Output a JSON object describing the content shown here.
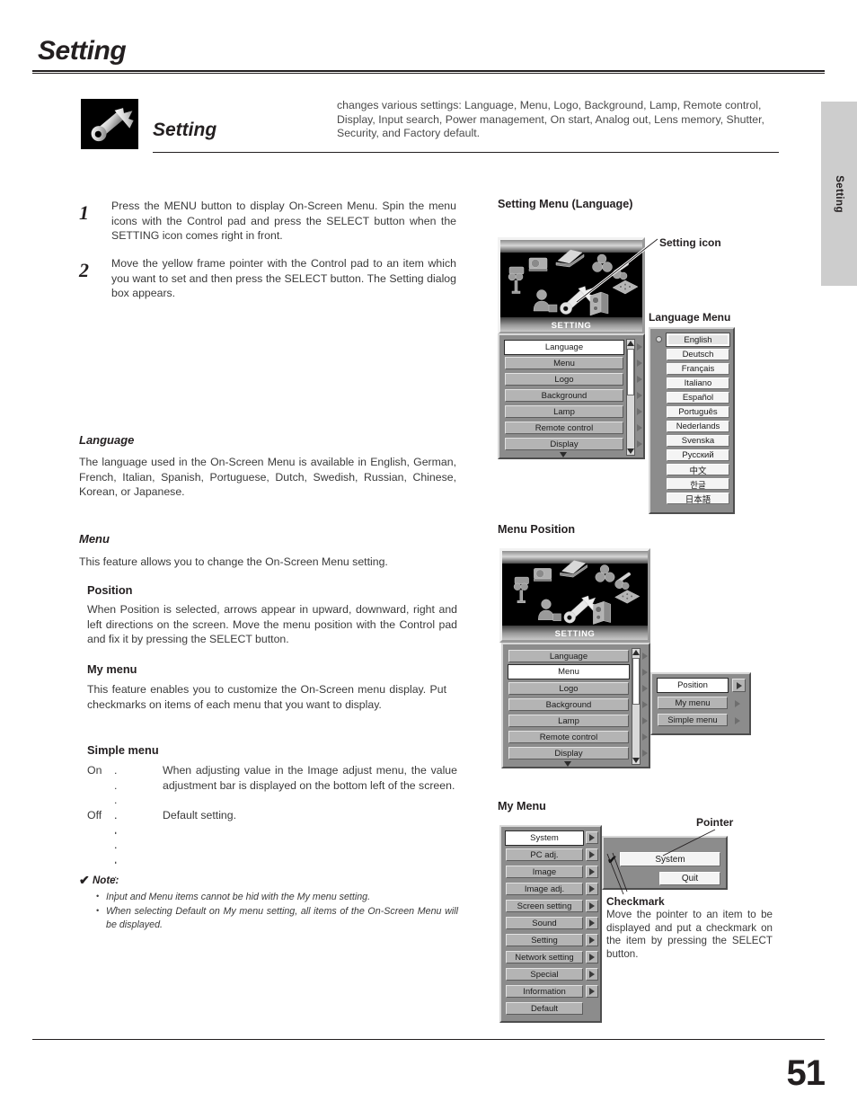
{
  "page": {
    "title": "Setting",
    "number": "51",
    "side_tab_label": "Setting"
  },
  "banner": {
    "icon_name": "setting-wrench-icon",
    "title": "Setting",
    "description": "changes various settings: Language, Menu, Logo, Background, Lamp, Remote control, Display, Input search, Power management, On start, Analog out, Lens memory, Shutter, Security, and Factory default."
  },
  "steps": [
    {
      "number": "1",
      "text": "Press the MENU button to display On-Screen Menu.  Spin the menu icons with the Control pad and press the SELECT button when the SETTING icon comes right in front."
    },
    {
      "number": "2",
      "text": "Move the yellow frame pointer with the Control pad to an item which you want to set and then press the SELECT button.  The Setting dialog box appears."
    }
  ],
  "sections": {
    "language": {
      "heading": "Language",
      "body": "The language used in the On-Screen Menu is available in English, German, French, Italian, Spanish, Portuguese, Dutch, Swedish, Russian, Chinese, Korean, or Japanese."
    },
    "menu": {
      "heading": "Menu",
      "body": "This feature allows you to change the On-Screen Menu setting."
    },
    "position": {
      "heading": "Position",
      "body": "When Position is selected, arrows appear in upward, downward, right and left directions on the screen.  Move the menu position with the Control pad and fix it by pressing the SELECT button."
    },
    "my_menu": {
      "heading": "My menu",
      "body": "This feature enables you to customize the On-Screen menu display.  Put checkmarks on items of each menu that you want to display."
    },
    "simple_menu": {
      "heading": "Simple menu",
      "rows": [
        {
          "term": "On",
          "dots": ". . . . . . .",
          "definition": "When adjusting value in the Image adjust menu, the value adjustment bar is displayed on the bottom left of the screen."
        },
        {
          "term": "Off",
          "dots": ". . . . . . .",
          "definition": "Default setting."
        }
      ]
    }
  },
  "note": {
    "check_glyph": "✔",
    "label": "Note:",
    "items": [
      "Input and Menu items cannot be hid with the My menu setting.",
      "When selecting Default on My menu setting, all items of the On-Screen Menu will be displayed."
    ]
  },
  "figures": {
    "setting_menu_language": {
      "heading": "Setting Menu (Language)",
      "callout_setting_icon": "Setting icon",
      "callout_language_menu": "Language Menu",
      "osd_label": "SETTING",
      "menu_items": [
        "Language",
        "Menu",
        "Logo",
        "Background",
        "Lamp",
        "Remote control",
        "Display"
      ],
      "selected_item": "Language",
      "languages": [
        "English",
        "Deutsch",
        "Français",
        "Italiano",
        "Español",
        "Português",
        "Nederlands",
        "Svenska",
        "Русский",
        "中文",
        "한글",
        "日本語"
      ],
      "selected_language": "English"
    },
    "menu_position": {
      "heading": "Menu Position",
      "osd_label": "SETTING",
      "menu_items": [
        "Language",
        "Menu",
        "Logo",
        "Background",
        "Lamp",
        "Remote control",
        "Display"
      ],
      "selected_item": "Menu",
      "submenu_items": [
        "Position",
        "My menu",
        "Simple menu"
      ],
      "selected_submenu": "Position"
    },
    "my_menu": {
      "heading": "My Menu",
      "callout_pointer": "Pointer",
      "menu_items": [
        "System",
        "PC adj.",
        "Image",
        "Image adj.",
        "Screen setting",
        "Sound",
        "Setting",
        "Network setting",
        "Special",
        "Information",
        "Default"
      ],
      "selected_item": "System",
      "dialog_items": [
        "System",
        "Quit"
      ],
      "checkmark_glyph": "✔",
      "caption_heading": "Checkmark",
      "caption_body": "Move the pointer to an item to be displayed and put a checkmark on the item by pressing the SELECT button."
    }
  }
}
